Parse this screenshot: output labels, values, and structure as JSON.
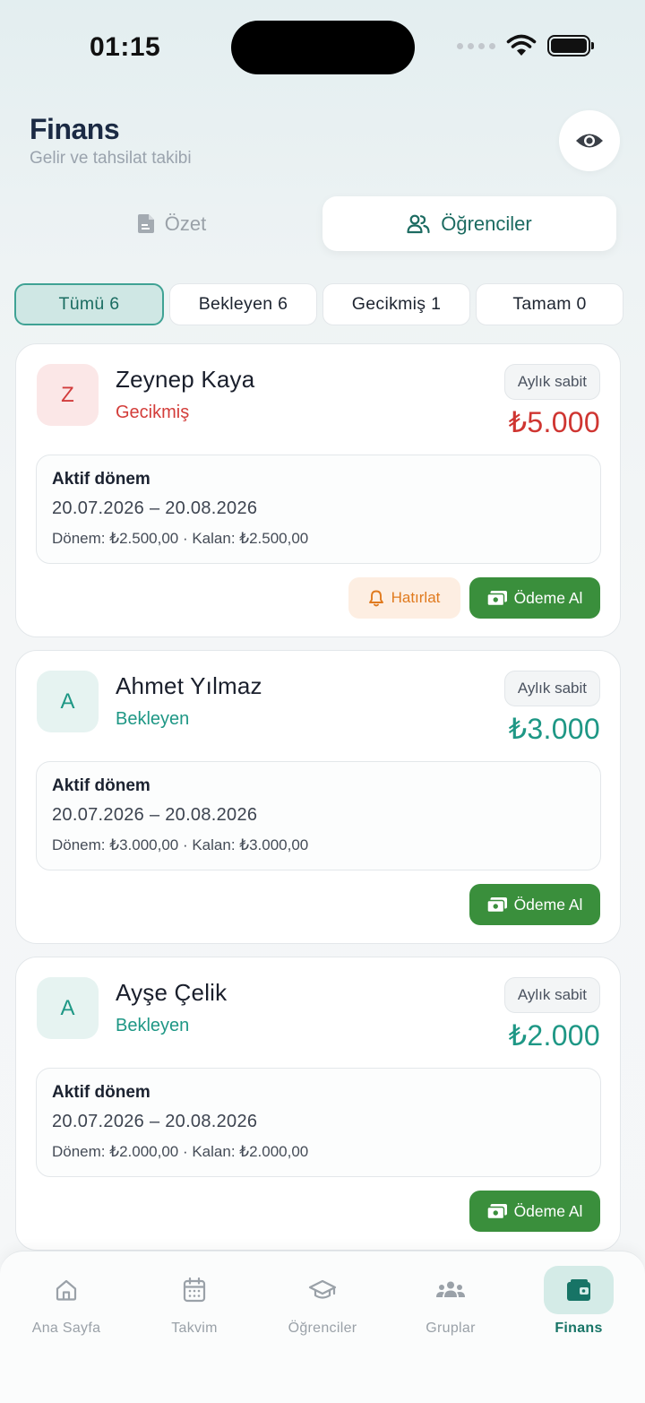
{
  "status_bar": {
    "time": "01:15"
  },
  "header": {
    "title": "Finans",
    "subtitle": "Gelir ve tahsilat takibi",
    "visibility_icon": "eye-icon"
  },
  "segments": [
    {
      "label": "Özet",
      "icon": "document-icon",
      "active": false
    },
    {
      "label": "Öğrenciler",
      "icon": "users-icon",
      "active": true
    }
  ],
  "filters": [
    {
      "label": "Tümü 6",
      "active": true
    },
    {
      "label": "Bekleyen 6",
      "active": false
    },
    {
      "label": "Gecikmiş 1",
      "active": false
    },
    {
      "label": "Tamam 0",
      "active": false
    }
  ],
  "students": [
    {
      "initial": "Z",
      "name": "Zeynep Kaya",
      "status": "Gecikmiş",
      "plan": "Aylık sabit",
      "amount": "₺5.000",
      "period_title": "Aktif dönem",
      "period_dates": "20.07.2026 – 20.08.2026",
      "period_detail": "Dönem: ₺2.500,00 · Kalan: ₺2.500,00",
      "remind_label": "Hatırlat",
      "pay_label": "Ödeme Al"
    },
    {
      "initial": "A",
      "name": "Ahmet Yılmaz",
      "status": "Bekleyen",
      "plan": "Aylık sabit",
      "amount": "₺3.000",
      "period_title": "Aktif dönem",
      "period_dates": "20.07.2026 – 20.08.2026",
      "period_detail": "Dönem: ₺3.000,00 · Kalan: ₺3.000,00",
      "pay_label": "Ödeme Al"
    },
    {
      "initial": "A",
      "name": "Ayşe Çelik",
      "status": "Bekleyen",
      "plan": "Aylık sabit",
      "amount": "₺2.000",
      "period_title": "Aktif dönem",
      "period_dates": "20.07.2026 – 20.08.2026",
      "period_detail": "Dönem: ₺2.000,00 · Kalan: ₺2.000,00",
      "pay_label": "Ödeme Al"
    }
  ],
  "nav": [
    {
      "label": "Ana Sayfa",
      "icon": "home-icon",
      "active": false
    },
    {
      "label": "Takvim",
      "icon": "calendar-icon",
      "active": false
    },
    {
      "label": "Öğrenciler",
      "icon": "graduation-cap-icon",
      "active": false
    },
    {
      "label": "Gruplar",
      "icon": "group-icon",
      "active": false
    },
    {
      "label": "Finans",
      "icon": "wallet-icon",
      "active": true
    }
  ],
  "colors": {
    "accent": "#1e9785",
    "overdue": "#cf3531",
    "pay_button": "#3a8f3c",
    "remind": "#e07a1e"
  }
}
